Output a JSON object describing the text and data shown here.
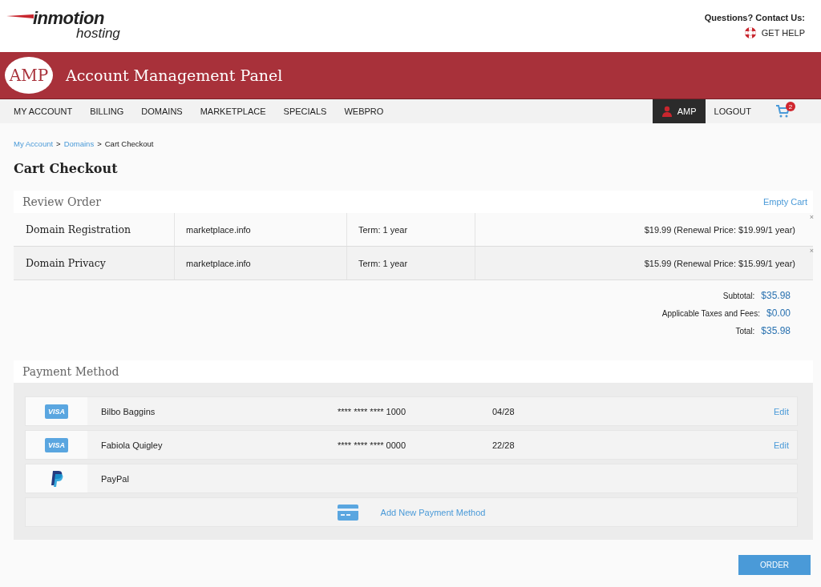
{
  "header": {
    "logo_main": "inmotion",
    "logo_sub": "hosting",
    "contact_label": "Questions? Contact Us:",
    "help_link": "GET HELP"
  },
  "banner": {
    "badge": "AMP",
    "title": "Account Management Panel"
  },
  "nav": {
    "items": [
      {
        "label": "MY ACCOUNT",
        "selected": false
      },
      {
        "label": "BILLING",
        "selected": false
      },
      {
        "label": "DOMAINS",
        "selected": false
      },
      {
        "label": "MARKETPLACE",
        "selected": false
      },
      {
        "label": "SPECIALS",
        "selected": false
      },
      {
        "label": "WEBPRO",
        "selected": false
      }
    ],
    "user": {
      "label": "AMP",
      "selected": true
    },
    "logout": "LOGOUT",
    "cart_count": "2"
  },
  "breadcrumb": [
    {
      "kind": "link",
      "label": "My Account"
    },
    {
      "kind": "separator",
      "label": ">"
    },
    {
      "kind": "link",
      "label": "Domains"
    },
    {
      "kind": "separator",
      "label": ">"
    },
    {
      "kind": "current",
      "label": "Cart Checkout"
    }
  ],
  "page_title": "Cart Checkout",
  "review": {
    "title": "Review Order",
    "empty_cart": "Empty Cart",
    "rows": [
      {
        "product": "Domain Registration",
        "domain": "marketplace.info",
        "term": "Term: 1 year",
        "price": "$19.99 (Renewal Price: $19.99/1 year)",
        "remove": "×"
      },
      {
        "product": "Domain Privacy",
        "domain": "marketplace.info",
        "term": "Term: 1 year",
        "price": "$15.99 (Renewal Price: $15.99/1 year)",
        "remove": "×"
      }
    ],
    "totals": [
      {
        "label": "Subtotal:",
        "value": "$35.98"
      },
      {
        "label": "Applicable Taxes and Fees:",
        "value": "$0.00"
      },
      {
        "label": "Total:",
        "value": "$35.98"
      }
    ]
  },
  "payment": {
    "title": "Payment Method",
    "methods": [
      {
        "kind": "card",
        "brand": "VISA",
        "name": "Bilbo Baggins",
        "number": "**** **** **** 1000",
        "expiry": "04/28",
        "action": "Edit"
      },
      {
        "kind": "card",
        "brand": "VISA",
        "name": "Fabiola Quigley",
        "number": "**** **** **** 0000",
        "expiry": "22/28",
        "action": "Edit"
      },
      {
        "kind": "paypal",
        "name": "PayPal"
      }
    ],
    "add": "Add New Payment Method"
  },
  "order_button": "ORDER"
}
